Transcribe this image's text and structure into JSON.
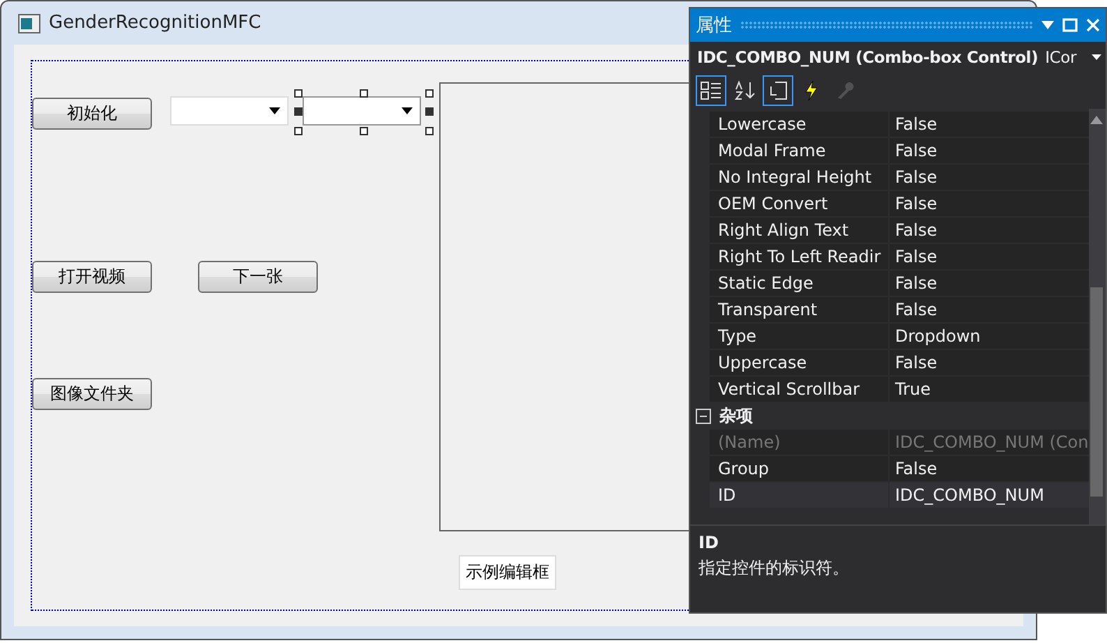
{
  "window": {
    "title": "GenderRecognitionMFC"
  },
  "dialog_controls": [
    {
      "kind": "button",
      "label": "初始化",
      "selected": false
    },
    {
      "kind": "combo",
      "selected": false
    },
    {
      "kind": "combo",
      "selected": true
    },
    {
      "kind": "picture",
      "selected": false
    },
    {
      "kind": "button",
      "label": "打开视频",
      "selected": false
    },
    {
      "kind": "button",
      "label": "下一张",
      "selected": false
    },
    {
      "kind": "button",
      "label": "图像文件夹",
      "selected": false
    },
    {
      "kind": "edit",
      "label": "示例编辑框",
      "selected": false
    }
  ],
  "properties_panel": {
    "title": "属性",
    "subject": "IDC_COMBO_NUM (Combo-box Control)",
    "subject_extra": "ICor",
    "toolbar": [
      {
        "kind": "categorized",
        "selected": true,
        "disabled": false
      },
      {
        "kind": "alphabetical",
        "selected": false,
        "disabled": false
      },
      {
        "kind": "properties",
        "selected": true,
        "disabled": false
      },
      {
        "kind": "events",
        "selected": false,
        "disabled": false
      },
      {
        "kind": "pages",
        "selected": false,
        "disabled": true
      }
    ],
    "rows": [
      {
        "kind": "property",
        "name": "Lowercase",
        "value": "False",
        "disabled": false,
        "selected": false
      },
      {
        "kind": "property",
        "name": "Modal Frame",
        "value": "False",
        "disabled": false,
        "selected": false
      },
      {
        "kind": "property",
        "name": "No Integral Height",
        "value": "False",
        "disabled": false,
        "selected": false
      },
      {
        "kind": "property",
        "name": "OEM Convert",
        "value": "False",
        "disabled": false,
        "selected": false
      },
      {
        "kind": "property",
        "name": "Right Align Text",
        "value": "False",
        "disabled": false,
        "selected": false
      },
      {
        "kind": "property",
        "name": "Right To Left Readir",
        "value": "False",
        "disabled": false,
        "selected": false
      },
      {
        "kind": "property",
        "name": "Static Edge",
        "value": "False",
        "disabled": false,
        "selected": false
      },
      {
        "kind": "property",
        "name": "Transparent",
        "value": "False",
        "disabled": false,
        "selected": false
      },
      {
        "kind": "property",
        "name": "Type",
        "value": "Dropdown",
        "disabled": false,
        "selected": false
      },
      {
        "kind": "property",
        "name": "Uppercase",
        "value": "False",
        "disabled": false,
        "selected": false
      },
      {
        "kind": "property",
        "name": "Vertical Scrollbar",
        "value": "True",
        "disabled": false,
        "selected": false
      },
      {
        "kind": "category",
        "name": "杂项",
        "expanded": true
      },
      {
        "kind": "property",
        "name": "(Name)",
        "value": "IDC_COMBO_NUM (Con",
        "disabled": true,
        "selected": false
      },
      {
        "kind": "property",
        "name": "Group",
        "value": "False",
        "disabled": false,
        "selected": false
      },
      {
        "kind": "property",
        "name": "ID",
        "value": "IDC_COMBO_NUM",
        "disabled": false,
        "selected": true
      }
    ],
    "description": {
      "title": "ID",
      "text": "指定控件的标识符。"
    }
  }
}
